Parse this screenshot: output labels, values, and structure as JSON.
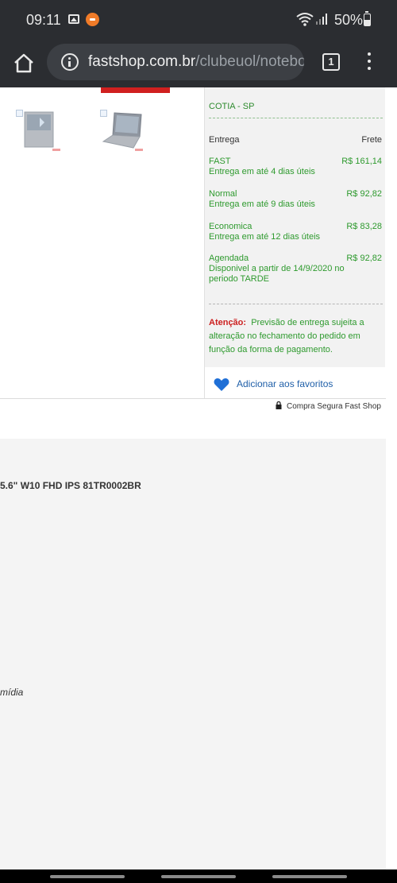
{
  "status_bar": {
    "time": "09:11",
    "battery": "50%"
  },
  "browser": {
    "url_host": "fastshop.com.br",
    "url_path": "/clubeuol/notebo",
    "tab_count": "1"
  },
  "shipping": {
    "city": "COTIA - SP",
    "header_delivery": "Entrega",
    "header_freight": "Frete",
    "options": [
      {
        "name": "FAST",
        "desc": "Entrega em até 4 dias úteis",
        "price": "R$ 161,14"
      },
      {
        "name": "Normal",
        "desc": "Entrega em até 9 dias úteis",
        "price": "R$ 92,82"
      },
      {
        "name": "Economica",
        "desc": "Entrega em até 12 dias úteis",
        "price": "R$ 83,28"
      },
      {
        "name": "Agendada",
        "desc": "Disponivel a partir de 14/9/2020 no periodo TARDE",
        "price": "R$ 92,82"
      }
    ],
    "warning_label": "Atenção:",
    "warning_text": "Previsão de entrega sujeita a alteração no fechamento do pedido em função da forma de pagamento."
  },
  "favorites": {
    "label": "Adicionar aos favoritos"
  },
  "secure_purchase": "Compra Segura Fast Shop",
  "product": {
    "title_fragment": "5.6\" W10 FHD IPS 81TR0002BR",
    "media_fragment": "mídia"
  },
  "colors": {
    "green_text": "#2e9a2e",
    "warning_red": "#cc1f1f",
    "link_blue": "#1f5fa8",
    "brand_red": "#d0201f"
  }
}
